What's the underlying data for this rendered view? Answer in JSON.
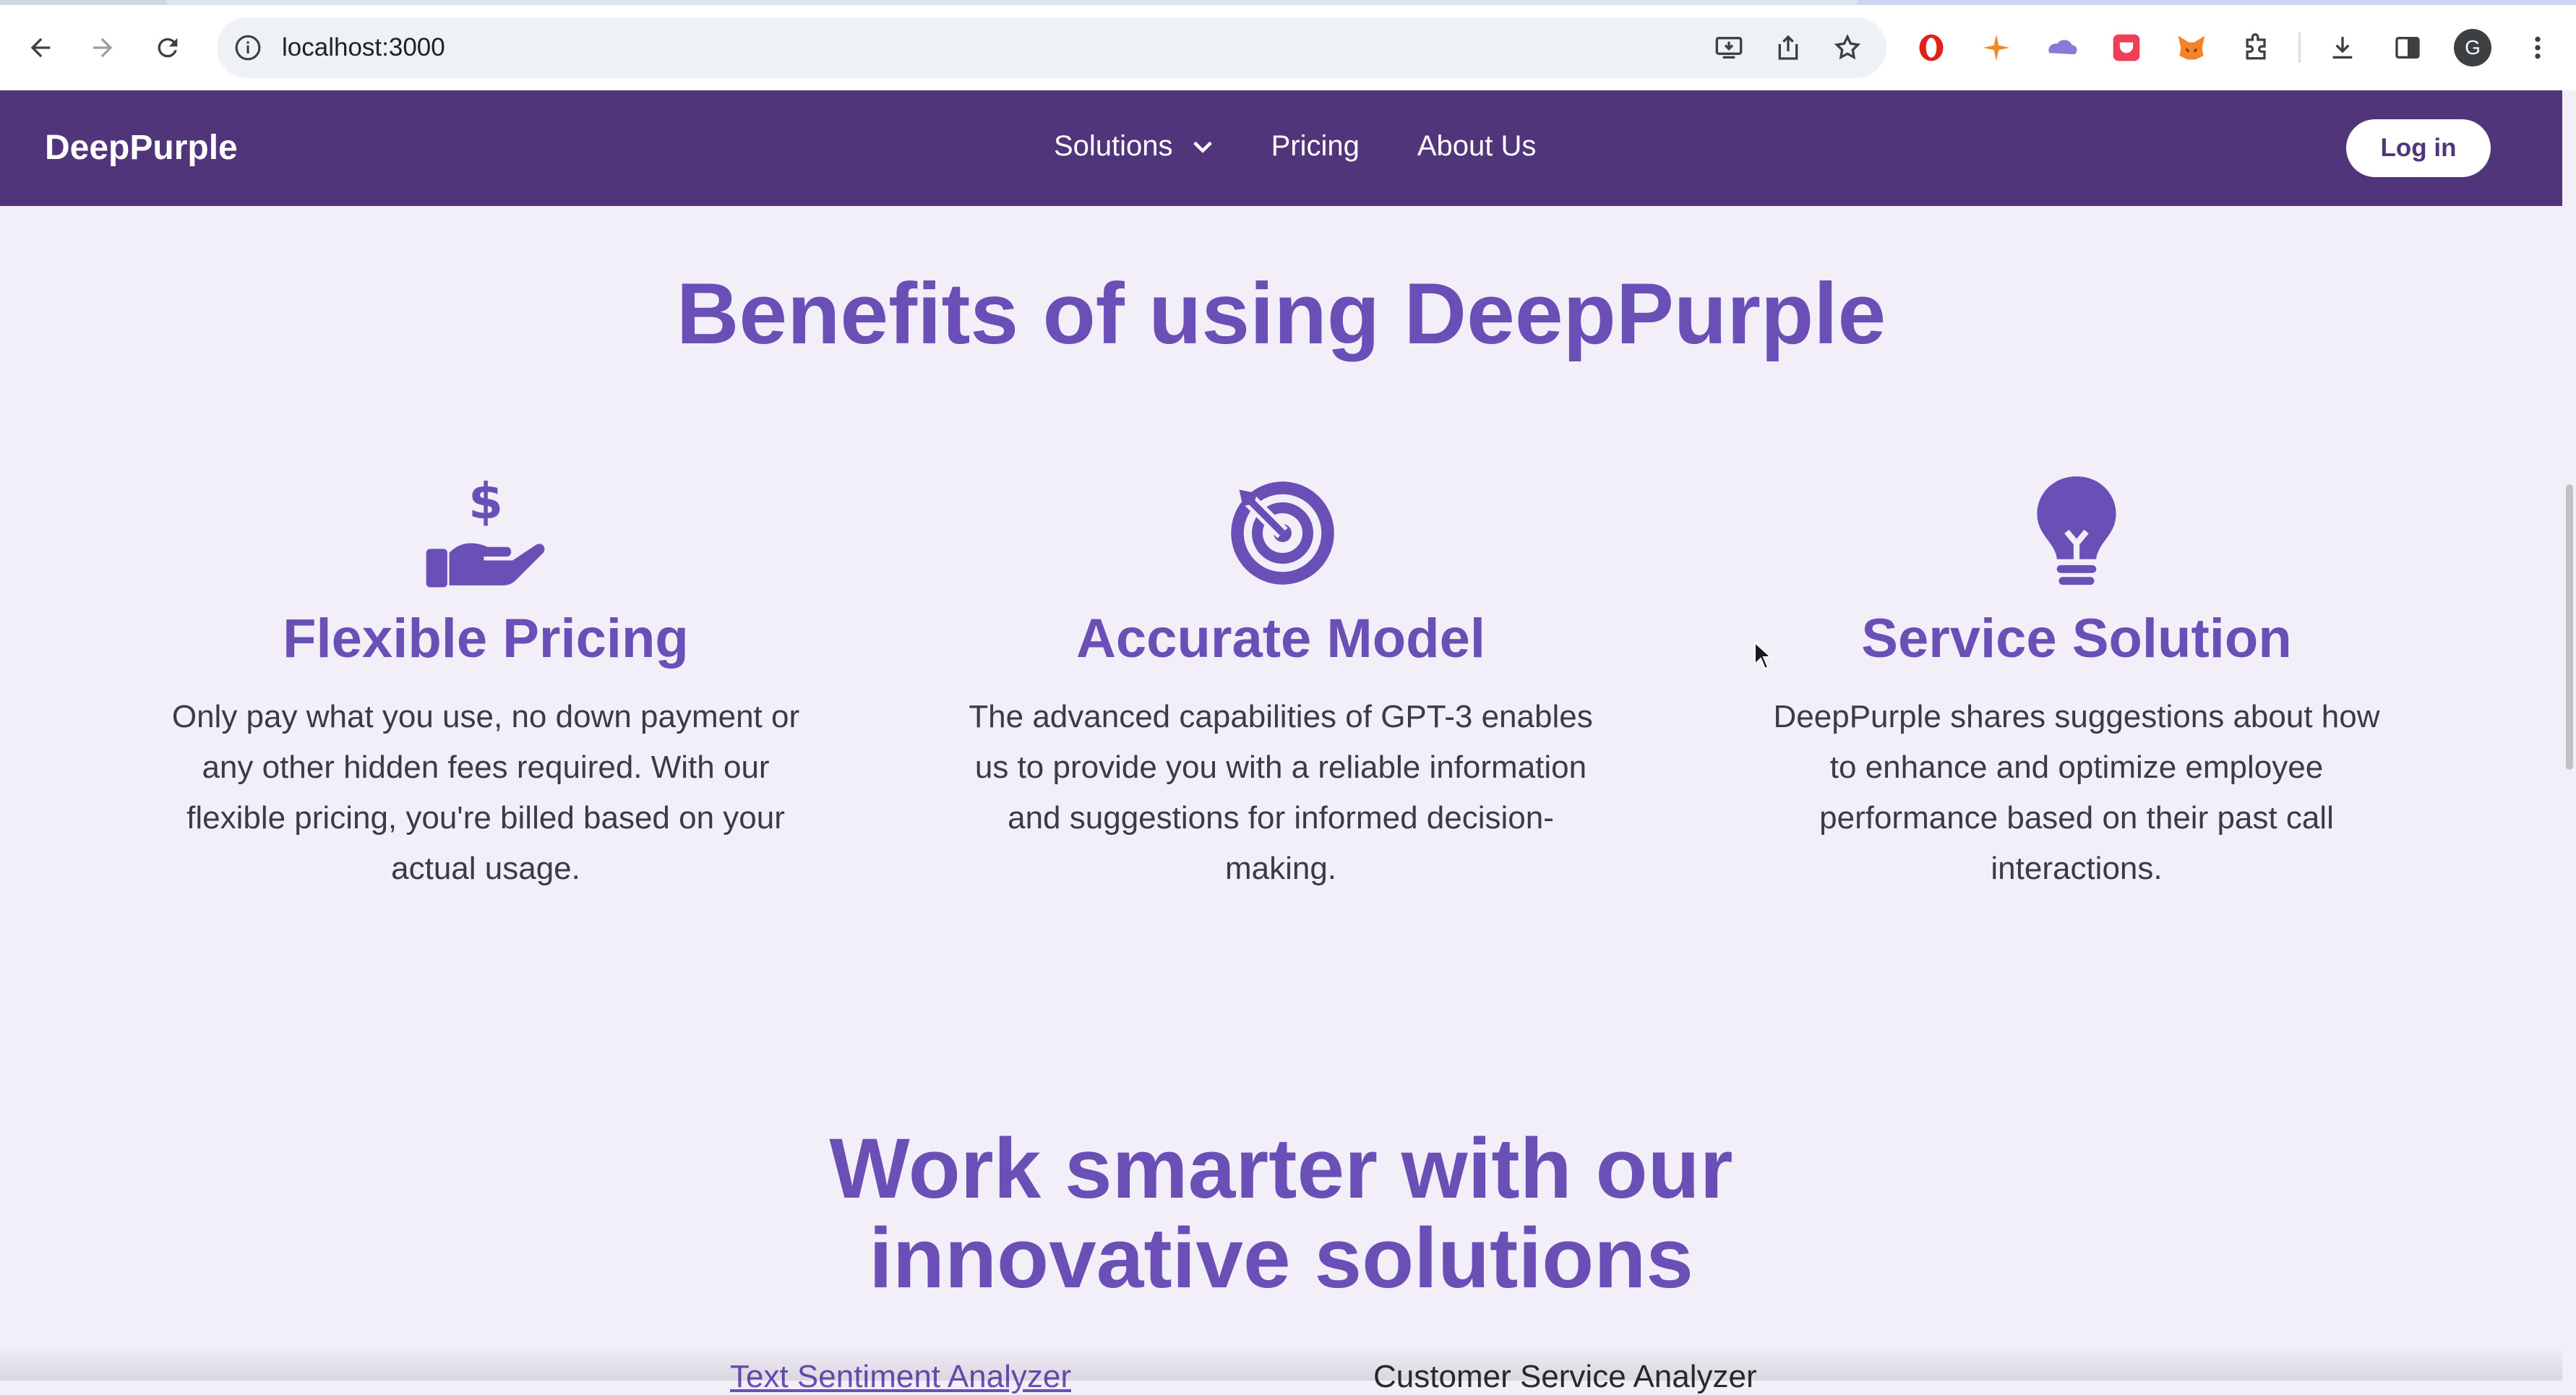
{
  "browser": {
    "url": "localhost:3000",
    "profile_initial": "G"
  },
  "header": {
    "brand": "DeepPurple",
    "menu": [
      {
        "label": "Solutions",
        "has_dropdown": true
      },
      {
        "label": "Pricing"
      },
      {
        "label": "About Us"
      }
    ],
    "login_label": "Log in"
  },
  "benefits": {
    "heading": "Benefits of using DeepPurple",
    "items": [
      {
        "icon": "hand-dollar-icon",
        "title": "Flexible Pricing",
        "text": "Only pay what you use, no down payment or any other hidden fees required. With our flexible pricing, you're billed based on your actual usage."
      },
      {
        "icon": "target-icon",
        "title": "Accurate Model",
        "text": "The advanced capabilities of GPT-3 enables us to provide you with a reliable information and suggestions for informed decision-making."
      },
      {
        "icon": "lightbulb-icon",
        "title": "Service Solution",
        "text": "DeepPurple shares suggestions about how to enhance and optimize employee performance based on their past call interactions."
      }
    ]
  },
  "solutions": {
    "heading_line1": "Work smarter with our",
    "heading_line2": "innovative solutions",
    "tabs": [
      "Text Sentiment Analyzer",
      "Customer Service Analyzer"
    ]
  },
  "colors": {
    "brand": "#51357b",
    "accent": "#6a4fb6",
    "background": "#f3eff9"
  }
}
